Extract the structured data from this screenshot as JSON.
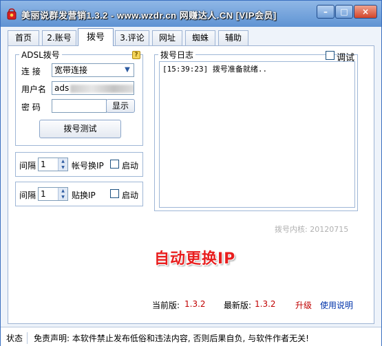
{
  "window": {
    "title": "美丽说群发营销1.3.2 - www.wzdr.cn 网赚达人.CN [VIP会员]",
    "minimize_glyph": "–",
    "maximize_glyph": "□",
    "close_glyph": "×"
  },
  "tabs": [
    {
      "label": "首页"
    },
    {
      "label": "2.账号"
    },
    {
      "label": "拨号",
      "active": true
    },
    {
      "label": "3.评论"
    },
    {
      "label": "网址"
    },
    {
      "label": "蜘蛛"
    },
    {
      "label": "辅助"
    }
  ],
  "adsl": {
    "group_title": "ADSL拨号",
    "help_glyph": "?",
    "connection_label": "连  接",
    "connection_value": "宽带连接",
    "username_label": "用户名",
    "username_value": "ads",
    "password_label": "密  码",
    "password_value": "",
    "show_button": "显示",
    "test_button": "拨号测试"
  },
  "account_switch": {
    "interval_label": "间隔",
    "interval_value": "1",
    "label": "帐号换IP",
    "auto_label": "启动",
    "auto_checked": false
  },
  "post_switch": {
    "interval_label": "间隔",
    "interval_value": "1",
    "label": "贴换IP",
    "auto_label": "启动",
    "auto_checked": false
  },
  "log": {
    "group_title": "拨号日志",
    "debug_label": "调试",
    "debug_checked": false,
    "lines": [
      "[15:39:23] 拨号准备就绪.."
    ]
  },
  "core_version": "拨号内核: 20120715",
  "banner": "自动更换IP",
  "versions": {
    "current_label": "当前版:",
    "current_value": "1.3.2",
    "latest_label": "最新版:",
    "latest_value": "1.3.2",
    "upgrade_link": "升级",
    "help_link": "使用说明"
  },
  "status": {
    "label": "状态",
    "text": "免责声明: 本软件禁止发布低俗和违法内容, 否则后果自负, 与软件作者无关!"
  },
  "colors": {
    "accent_red": "#c00000",
    "banner_red": "#e81e1e",
    "link_blue": "#0033aa",
    "titlebar": "#5f93d3"
  }
}
